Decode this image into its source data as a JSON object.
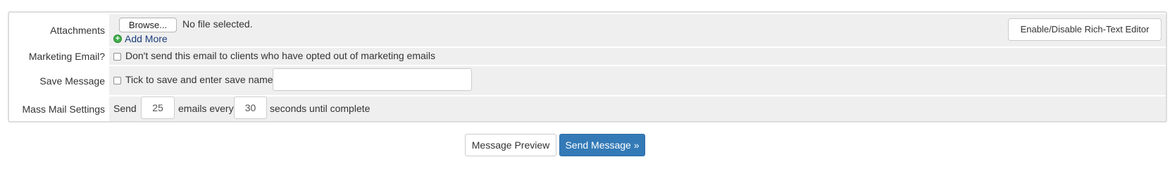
{
  "attachments": {
    "label": "Attachments",
    "browse_label": "Browse...",
    "file_status": "No file selected.",
    "add_more_label": "Add More",
    "add_icon": "plus-circle-icon"
  },
  "rich_text_toggle_label": "Enable/Disable Rich-Text Editor",
  "marketing": {
    "label": "Marketing Email?",
    "checkbox_label": "Don't send this email to clients who have opted out of marketing emails",
    "checked": false
  },
  "save_message": {
    "label": "Save Message",
    "checkbox_label": "Tick to save and enter save name:",
    "checked": false,
    "name_value": ""
  },
  "mass_mail": {
    "label": "Mass Mail Settings",
    "text_send": "Send",
    "emails_count": "25",
    "text_emails_every": "emails every",
    "seconds": "30",
    "text_until": "seconds until complete"
  },
  "actions": {
    "preview_label": "Message Preview",
    "send_label": "Send Message »"
  },
  "colors": {
    "primary": "#337ab7",
    "row_background": "#efefef",
    "add_icon": "#3fae49"
  }
}
